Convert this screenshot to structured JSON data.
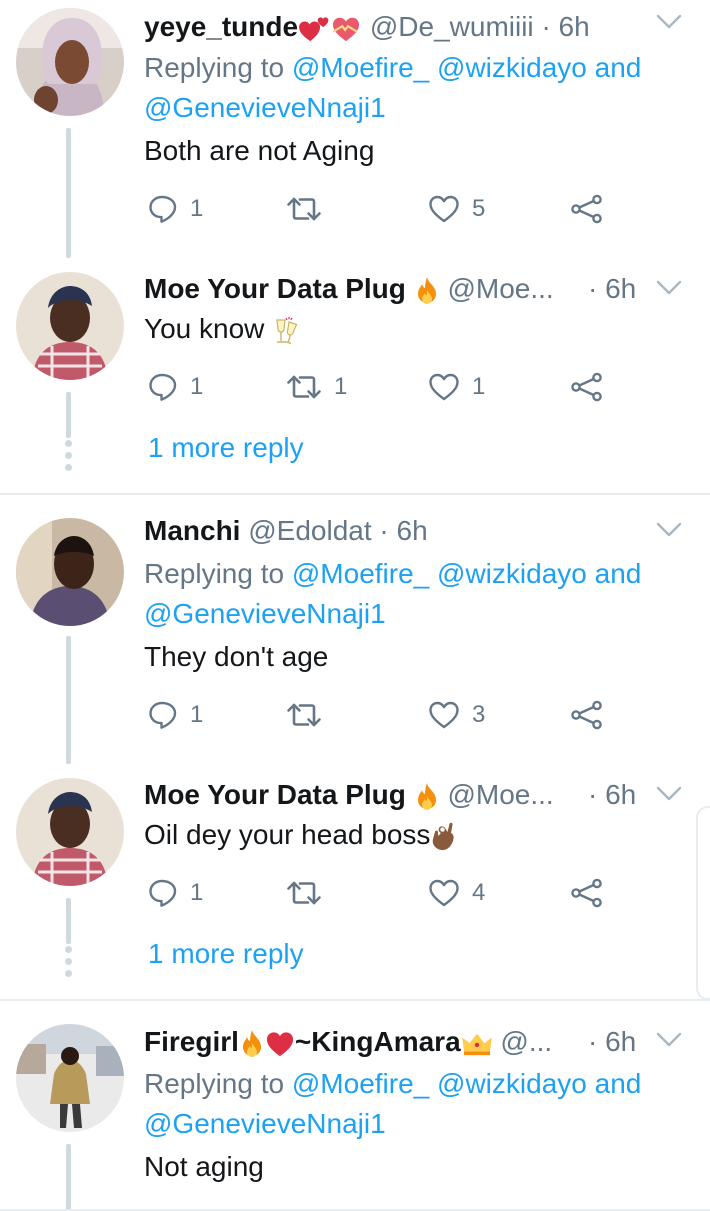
{
  "colors": {
    "accent": "#1da1f2",
    "text": "#14171a",
    "muted": "#657786",
    "divider": "#e6ecf0"
  },
  "tweets": [
    {
      "name": "yeye_tunde",
      "name_emojis": [
        "two-hearts-icon",
        "heart-with-ribbon-icon"
      ],
      "handle": "@De_wumiiii",
      "time": "· 6h",
      "reply_prefix": "Replying to",
      "reply_to_1": "@Moefire_",
      "reply_to_2": "@wizkidayo",
      "reply_and": "and",
      "reply_to_3": "@GenevieveNnaji1",
      "text": "Both are not Aging",
      "replies": "1",
      "retweets": "",
      "likes": "5"
    },
    {
      "name": "Moe Your Data Plug",
      "name_emojis": [
        "fire-icon"
      ],
      "handle": "@Moe...",
      "time": "· 6h",
      "text": "You know",
      "text_emoji": "clinking-glasses-icon",
      "replies": "1",
      "retweets": "1",
      "likes": "1",
      "more": "1 more reply"
    },
    {
      "name": "Manchi",
      "handle": "@Edoldat",
      "time": "· 6h",
      "reply_prefix": "Replying to",
      "reply_to_1": "@Moefire_",
      "reply_to_2": "@wizkidayo",
      "reply_and": "and",
      "reply_to_3": "@GenevieveNnaji1",
      "text": "They don't age",
      "replies": "1",
      "retweets": "",
      "likes": "3"
    },
    {
      "name": "Moe Your Data Plug",
      "name_emojis": [
        "fire-icon"
      ],
      "handle": "@Moe...",
      "time": "· 6h",
      "text": "Oil dey your head boss",
      "text_emoji": "ok-hand-icon",
      "replies": "1",
      "retweets": "",
      "likes": "4",
      "more": "1 more reply"
    },
    {
      "name": "Firegirl",
      "name_suffix": "~KingAmara",
      "name_emojis": [
        "fire-icon",
        "red-heart-icon",
        "crown-icon"
      ],
      "handle": "@...",
      "time": "· 6h",
      "reply_prefix": "Replying to",
      "reply_to_1": "@Moefire_",
      "reply_to_2": "@wizkidayo",
      "reply_and": "and",
      "reply_to_3": "@GenevieveNnaji1",
      "text": "Not aging"
    }
  ]
}
